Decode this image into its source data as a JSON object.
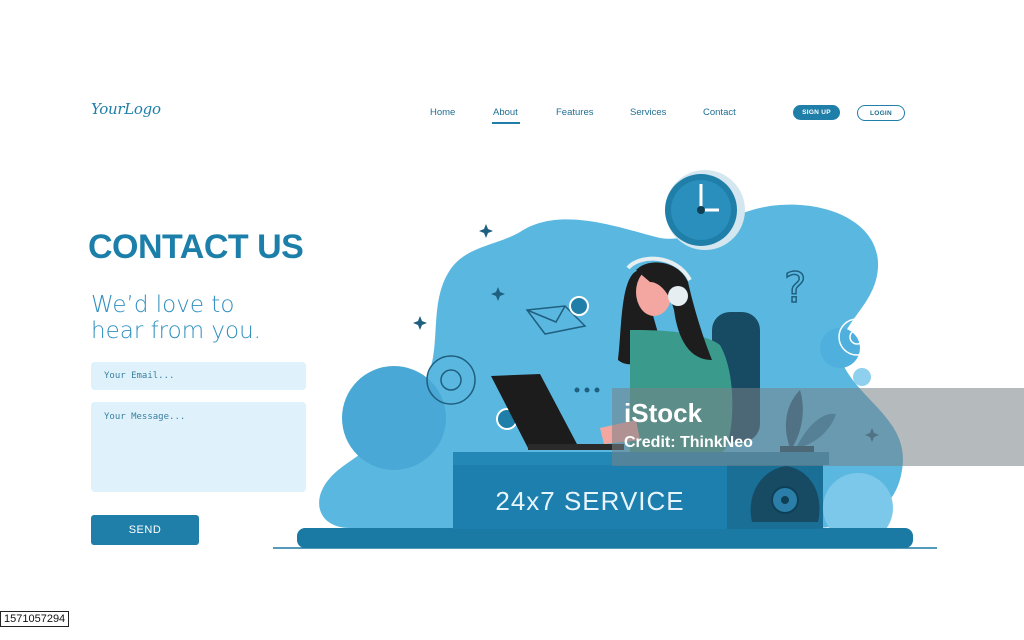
{
  "nav": {
    "logo": "YourLogo",
    "links": [
      "Home",
      "About",
      "Features",
      "Services",
      "Contact"
    ],
    "active": "About",
    "signup_label": "SIGN UP",
    "login_label": "LOGIN"
  },
  "hero": {
    "title": "CONTACT US",
    "subtitle_line1": "We’d love to",
    "subtitle_line2": "hear from you."
  },
  "form": {
    "email_placeholder": "Your Email...",
    "message_placeholder": "Your Message...",
    "send_label": "SEND"
  },
  "illustration": {
    "desk_sign": "24x7 SERVICE"
  },
  "watermark": {
    "brand": "iStock",
    "credit": "Credit: ThinkNeo",
    "image_number": "1571057294"
  },
  "colors": {
    "primary": "#1f7fa8",
    "light_blue": "#dff2fb",
    "blob": "#5ab8e0"
  }
}
